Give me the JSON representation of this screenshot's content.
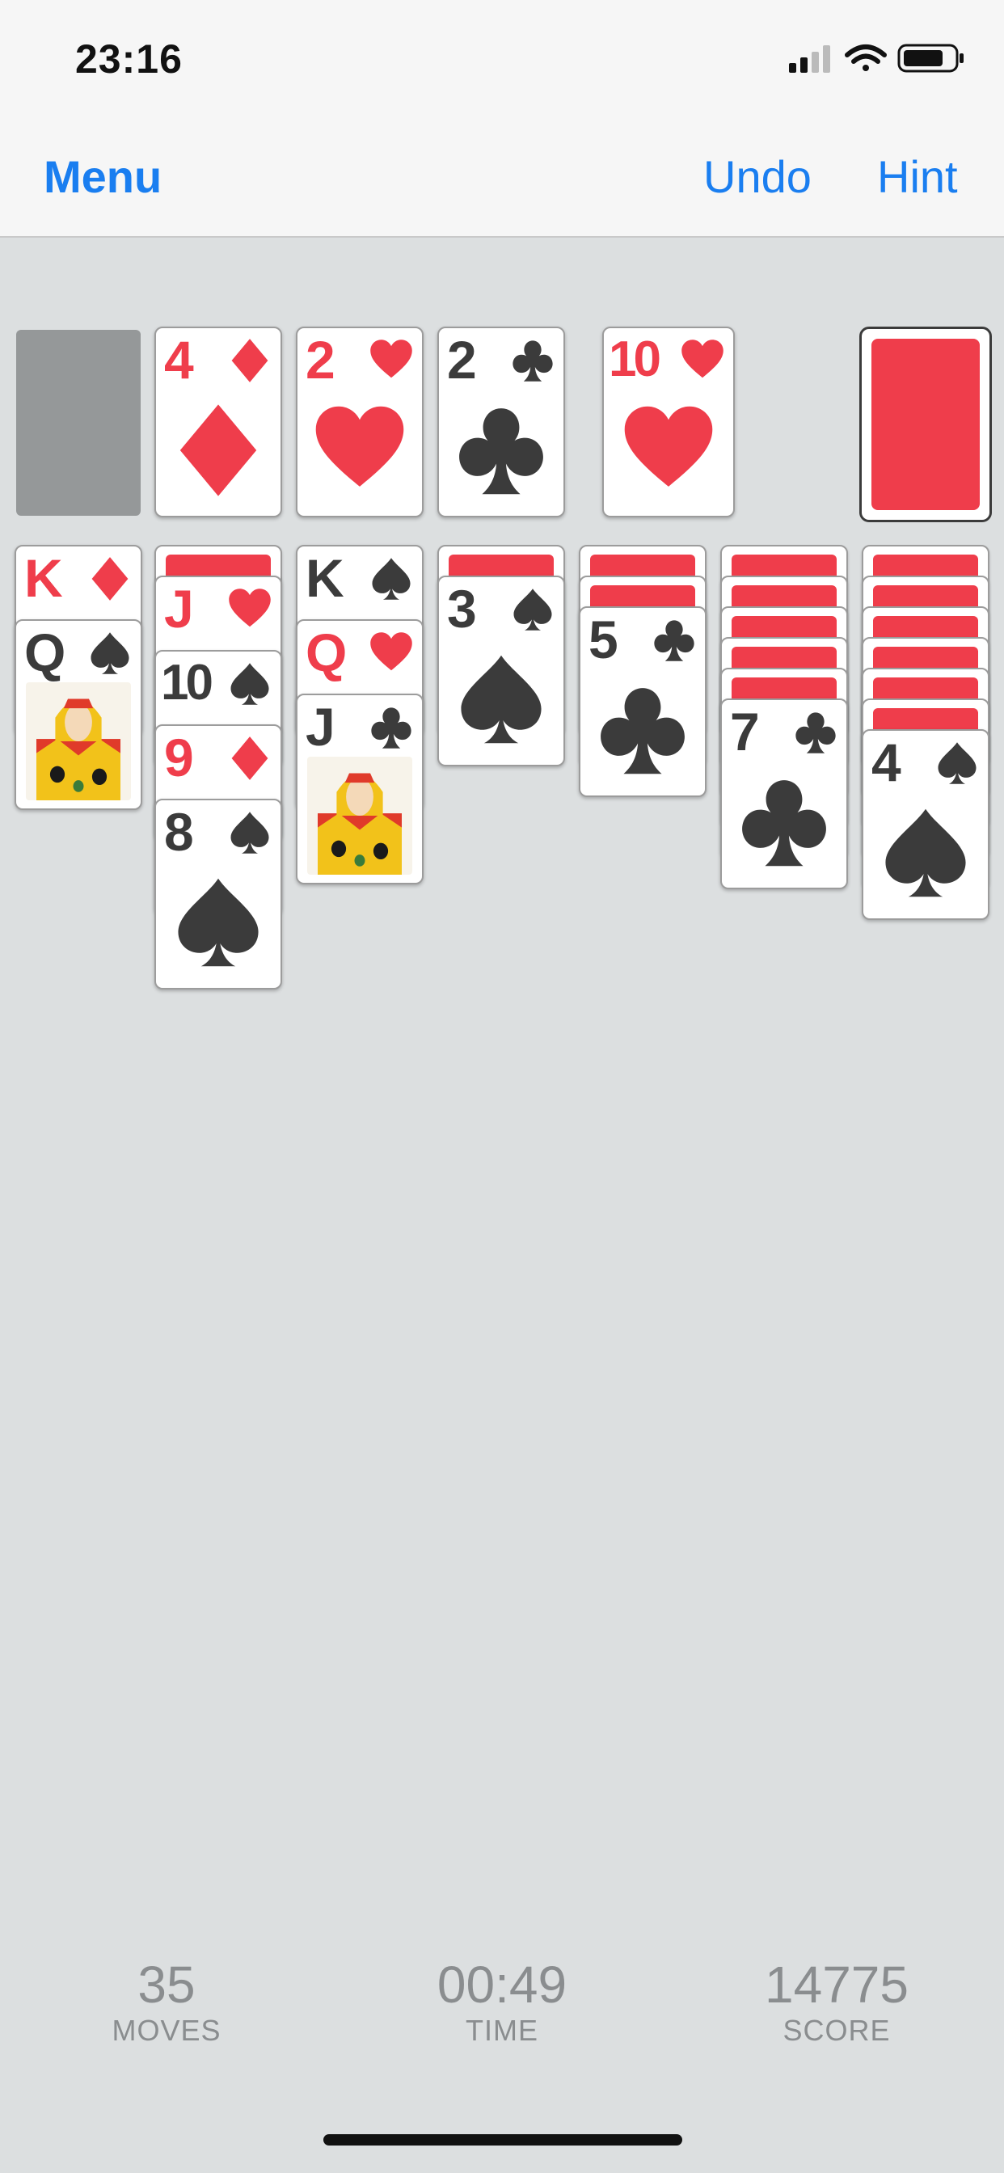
{
  "status": {
    "time": "23:16"
  },
  "nav": {
    "menu": "Menu",
    "undo": "Undo",
    "hint": "Hint"
  },
  "stats": {
    "moves": {
      "value": "35",
      "label": "MOVES"
    },
    "time": {
      "value": "00:49",
      "label": "TIME"
    },
    "score": {
      "value": "14775",
      "label": "SCORE"
    }
  },
  "colors": {
    "red": "#ef3d4b",
    "black": "#3b3b3b",
    "accent": "#1a7ef0",
    "felt": "#dcdfe0"
  },
  "foundations": [
    {
      "rank": "",
      "suit": "",
      "empty": true
    },
    {
      "rank": "4",
      "suit": "diamond"
    },
    {
      "rank": "2",
      "suit": "heart"
    },
    {
      "rank": "2",
      "suit": "club"
    }
  ],
  "waste": {
    "rank": "10",
    "suit": "heart"
  },
  "stock_icon": "card-back",
  "tableau": [
    {
      "hidden": 0,
      "cards": [
        {
          "rank": "K",
          "suit": "diamond"
        },
        {
          "rank": "Q",
          "suit": "spade",
          "face": "queen-icon"
        }
      ]
    },
    {
      "hidden": 1,
      "cards": [
        {
          "rank": "J",
          "suit": "heart"
        },
        {
          "rank": "10",
          "suit": "spade"
        },
        {
          "rank": "9",
          "suit": "diamond"
        },
        {
          "rank": "8",
          "suit": "spade"
        }
      ]
    },
    {
      "hidden": 0,
      "cards": [
        {
          "rank": "K",
          "suit": "spade"
        },
        {
          "rank": "Q",
          "suit": "heart"
        },
        {
          "rank": "J",
          "suit": "club",
          "face": "jack-icon"
        }
      ]
    },
    {
      "hidden": 1,
      "cards": [
        {
          "rank": "3",
          "suit": "spade"
        }
      ]
    },
    {
      "hidden": 2,
      "cards": [
        {
          "rank": "5",
          "suit": "club"
        }
      ]
    },
    {
      "hidden": 5,
      "cards": [
        {
          "rank": "7",
          "suit": "club"
        }
      ]
    },
    {
      "hidden": 6,
      "cards": [
        {
          "rank": "4",
          "suit": "spade"
        }
      ]
    }
  ]
}
